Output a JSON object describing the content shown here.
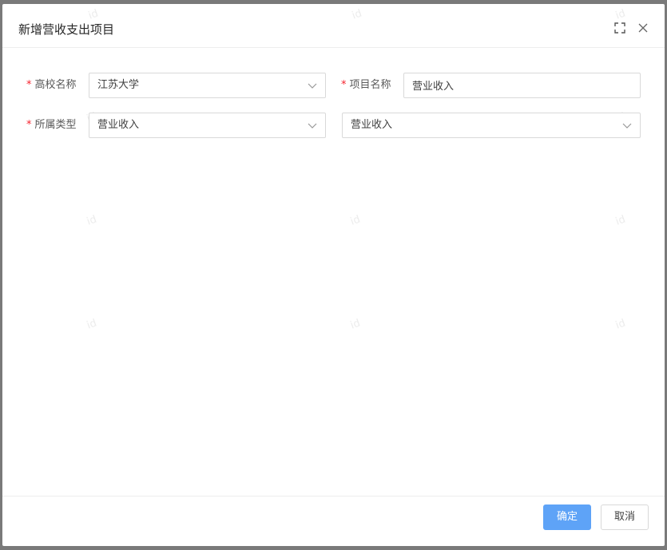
{
  "modal": {
    "title": "新增营收支出项目"
  },
  "watermark": "id",
  "form": {
    "school": {
      "label": "高校名称",
      "required_mark": "*",
      "value": "江苏大学"
    },
    "project": {
      "label": "项目名称",
      "required_mark": "*",
      "value": "营业收入"
    },
    "category": {
      "label": "所属类型",
      "required_mark": "*",
      "value": "营业收入"
    },
    "subcategory": {
      "value": "营业收入"
    }
  },
  "footer": {
    "confirm_label": "确定",
    "cancel_label": "取消"
  },
  "colors": {
    "primary": "#5ea3f7",
    "required": "#f5222d",
    "overlay": "#7a7a7a"
  },
  "icons": {
    "fullscreen": "fullscreen-icon",
    "close": "close-icon",
    "dropdown": "chevron-down-icon"
  }
}
